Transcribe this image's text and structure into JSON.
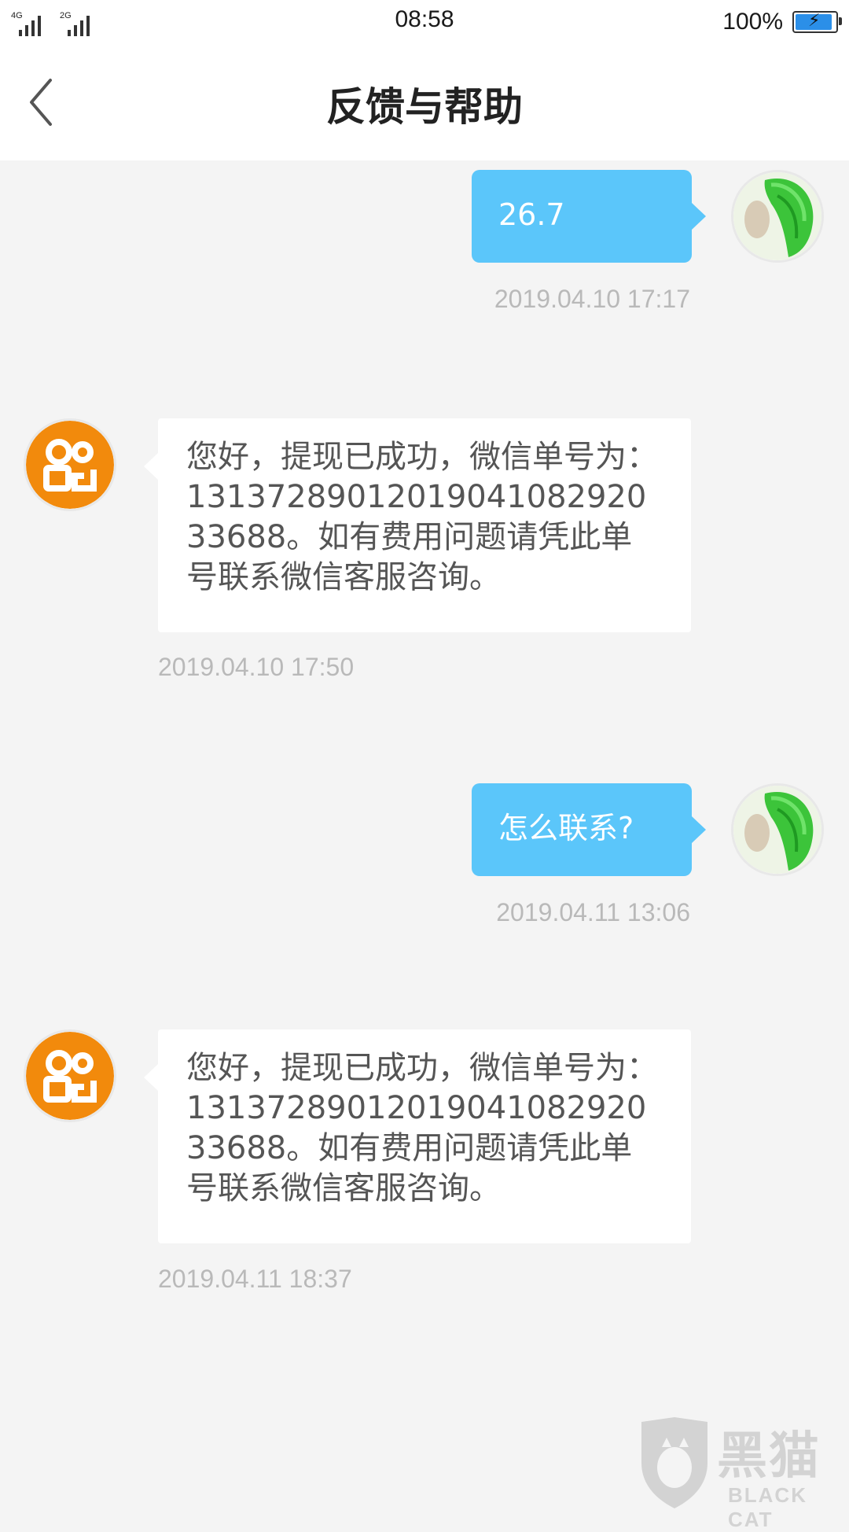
{
  "status_bar": {
    "network_1": "4G",
    "network_2": "2G",
    "time": "08:58",
    "battery_percent_text": "100%",
    "battery_level": 1.0
  },
  "header": {
    "title": "反馈与帮助",
    "back_icon": "chevron-left-icon"
  },
  "messages": [
    {
      "from": "user",
      "text": "26.7",
      "time": "2019.04.10 17:17"
    },
    {
      "from": "service",
      "text": "您好，提现已成功，微信单号为：13137289012019041082920336​88。如有费用问题请凭此单号联系微信客服咨询。",
      "time": "2019.04.10 17:50"
    },
    {
      "from": "user",
      "text": "怎么联系?",
      "time": "2019.04.11 13:06"
    },
    {
      "from": "service",
      "text": "您好，提现已成功，微信单号为：1313728901201904108292033688。如有费用问题请凭此单号联系微信客服咨询。",
      "time": "2019.04.11 18:37"
    }
  ],
  "watermark": {
    "cn": "黑猫",
    "en": "BLACK CAT"
  },
  "colors": {
    "user_bubble": "#5bc6fa",
    "service_bubble": "#ffffff",
    "background": "#f4f4f4",
    "brand_orange": "#f28a0c"
  }
}
